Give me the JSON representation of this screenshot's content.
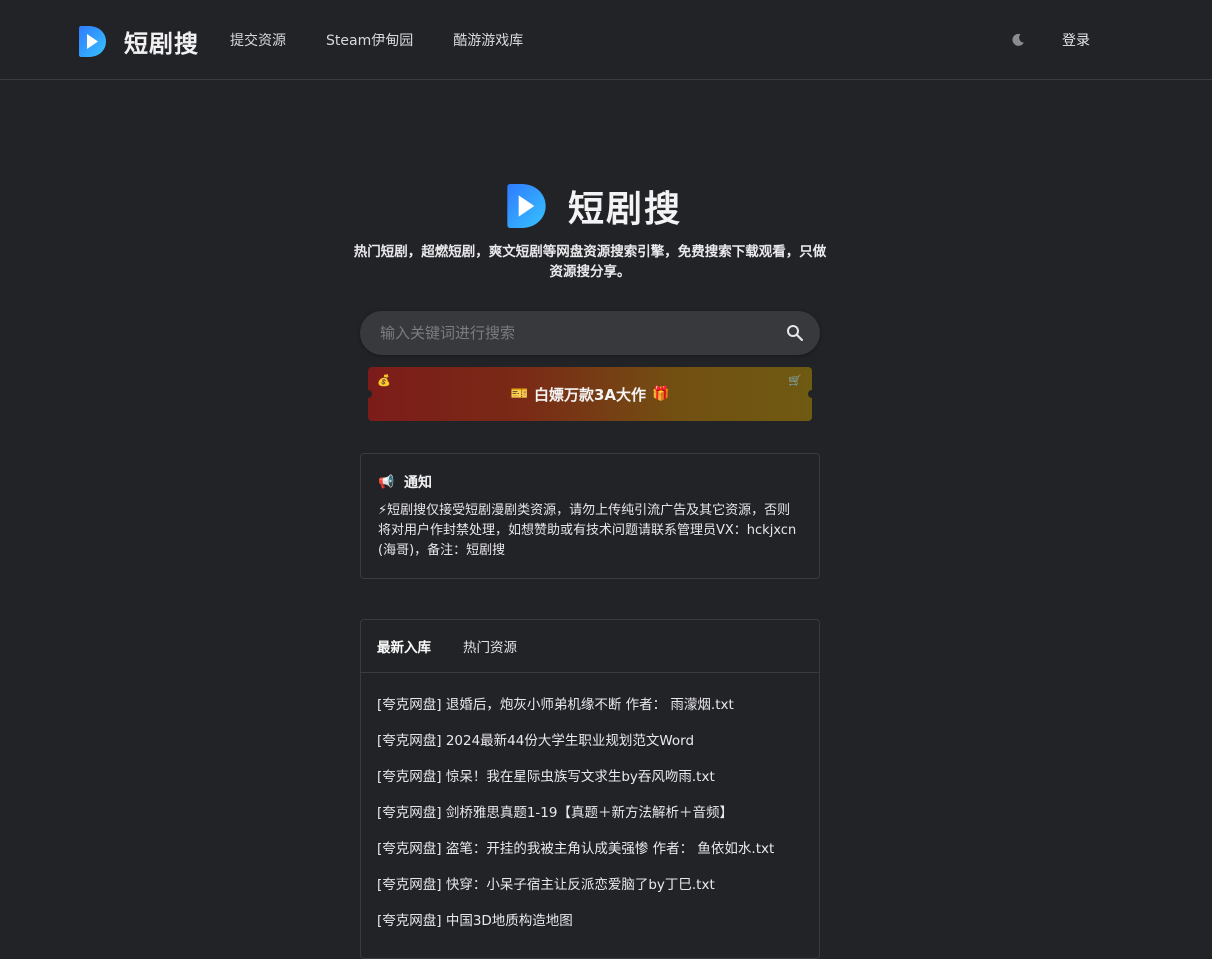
{
  "header": {
    "brand": "短剧搜",
    "nav": [
      "提交资源",
      "Steam伊甸园",
      "酷游游戏库"
    ],
    "theme_icon": "moon-icon",
    "login": "登录"
  },
  "hero": {
    "title": "短剧搜",
    "tagline": "热门短剧，超燃短剧，爽文短剧等网盘资源搜索引擎，免费搜索下载观看，只做资源搜分享。"
  },
  "search": {
    "placeholder": "输入关键词进行搜索",
    "icon": "search-icon"
  },
  "promo": {
    "text": "白嫖万款3A大作",
    "left_icon": "ticket-icon",
    "right_icon": "gift-icon",
    "corner_left_icon": "money-bag-icon",
    "corner_right_icon": "cart-icon",
    "gradient": [
      "#7c1c1a",
      "#6f5a12"
    ]
  },
  "notice": {
    "icon": "megaphone-icon",
    "title": "通知",
    "body": "⚡短剧搜仅接受短剧漫剧类资源，请勿上传纯引流广告及其它资源，否则将对用户作封禁处理，如想赞助或有技术问题请联系管理员VX：hckjxcn (海哥)，备注：短剧搜"
  },
  "tabs": [
    {
      "label": "最新入库",
      "active": true
    },
    {
      "label": "热门资源",
      "active": false
    }
  ],
  "items": [
    "[夸克网盘] 退婚后，炮灰小师弟机缘不断 作者： 雨濛烟.txt",
    "[夸克网盘] 2024最新44份大学生职业规划范文Word",
    "[夸克网盘] 惊呆！我在星际虫族写文求生by吞风吻雨.txt",
    "[夸克网盘] 剑桥雅思真题1-19【真题＋新方法解析＋音频】",
    "[夸克网盘] 盗笔：开挂的我被主角认成美强惨 作者： 鱼依如水.txt",
    "[夸克网盘] 快穿：小呆子宿主让反派恋爱脑了by丁巳.txt",
    "[夸克网盘] 中国3D地质构造地图"
  ],
  "colors": {
    "background": "#222327",
    "border": "#3a3b40",
    "logo_gradient": [
      "#2f7bff",
      "#37c3ff"
    ]
  }
}
